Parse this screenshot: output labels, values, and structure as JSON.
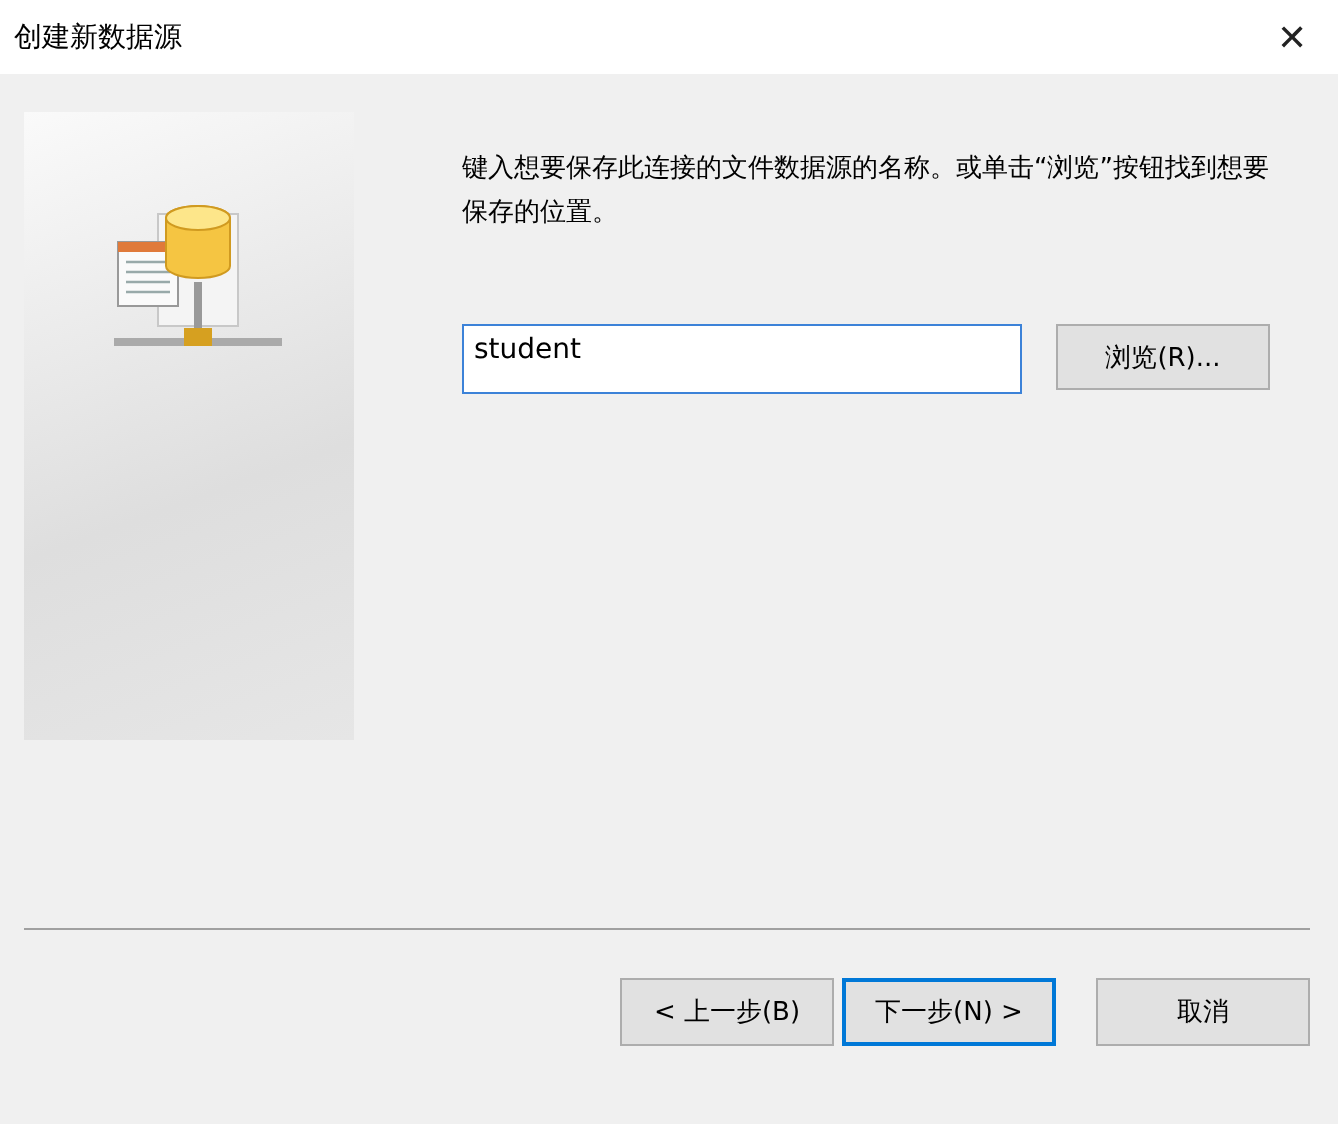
{
  "window": {
    "title": "创建新数据源",
    "close": "✕"
  },
  "instruction": "键入想要保存此连接的文件数据源的名称。或单击“浏览”按钮找到想要保存的位置。",
  "name_field": {
    "value": "student"
  },
  "browse_button": "浏览(R)...",
  "buttons": [
    {
      "label": "< 上一步(B)",
      "focused": false
    },
    {
      "label": "下一步(N) >",
      "focused": true
    },
    {
      "label": "取消",
      "focused": false
    }
  ]
}
